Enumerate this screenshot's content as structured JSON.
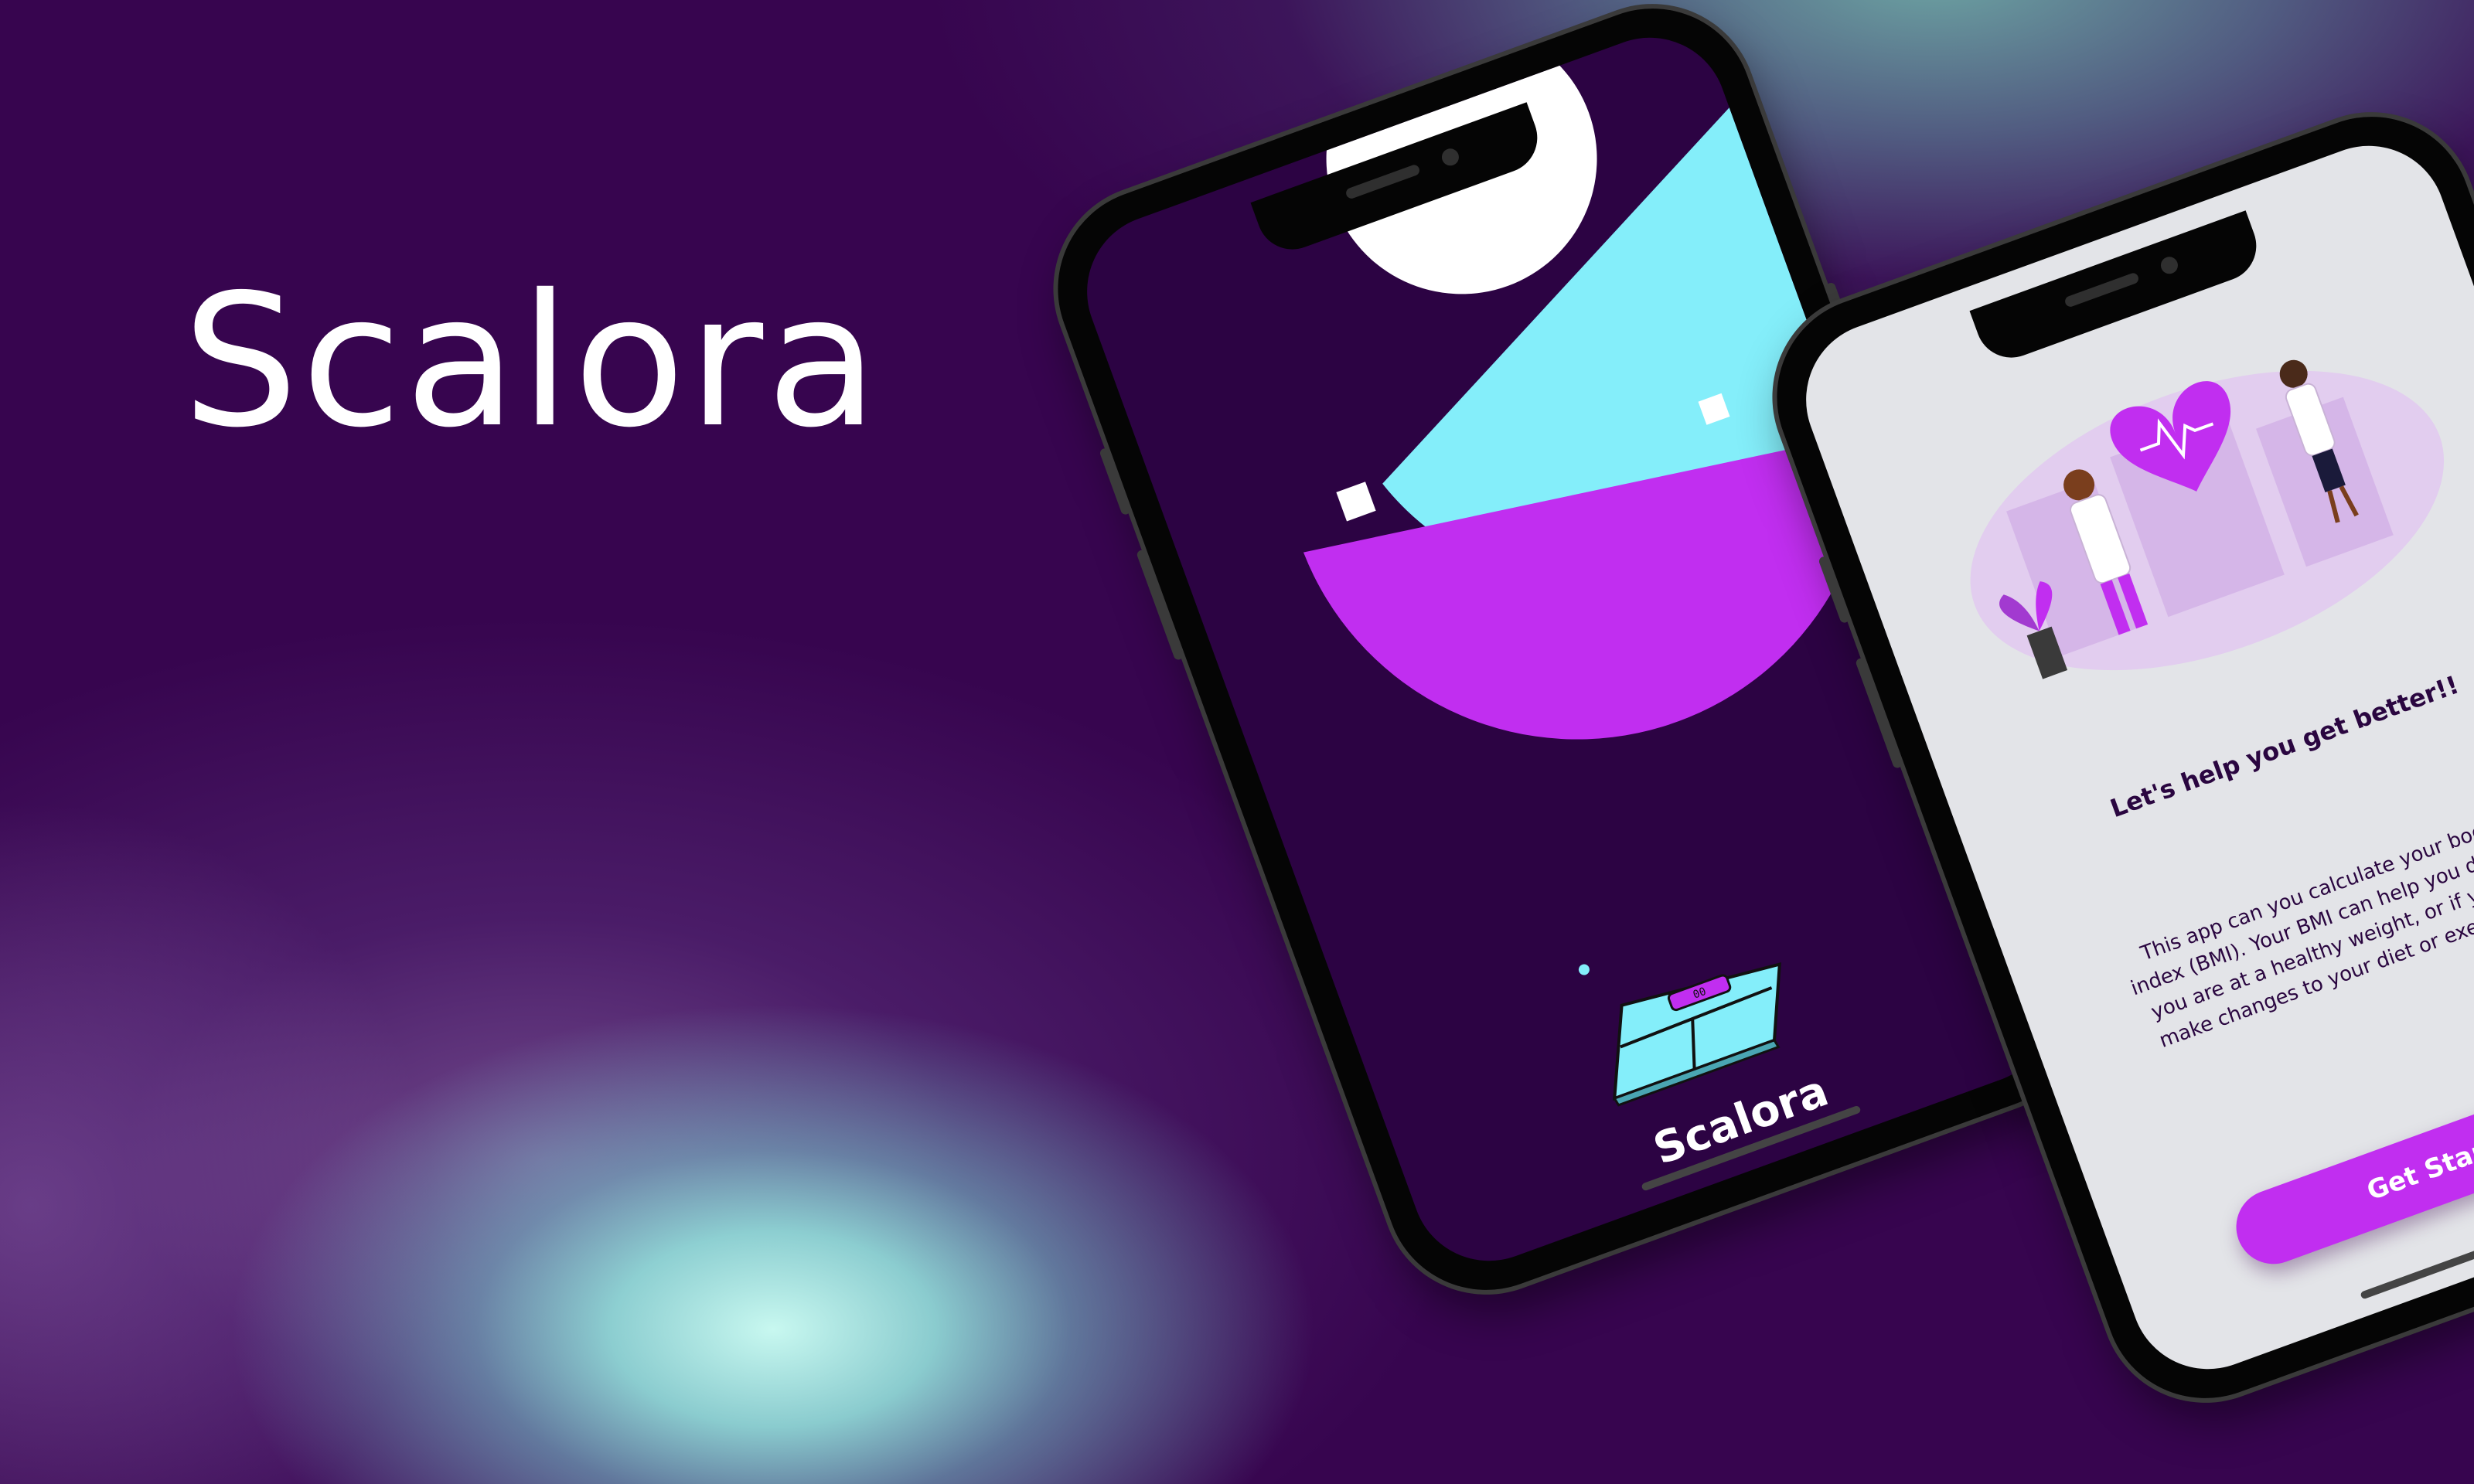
{
  "hero": {
    "title": "Scalora"
  },
  "splash": {
    "app_name": "Scalora",
    "scale_display": "00"
  },
  "onboarding": {
    "tagline": "Let's help you get better!!",
    "description": "This app can you calculate your body mass index (BMI). Your BMI can help you determine if you are at a healthy weight, or if you need to make changes to your diet or exercise habits.",
    "cta_label": "Get Started"
  },
  "colors": {
    "background": "#37054f",
    "accent_purple": "#c12ef0",
    "accent_cyan": "#84eefa",
    "white": "#ffffff",
    "splash_screen": "#2c0343",
    "onboarding_screen": "#e3e4e8"
  },
  "icons": [
    "scale-icon",
    "heart-pulse-icon",
    "plant-icon"
  ]
}
